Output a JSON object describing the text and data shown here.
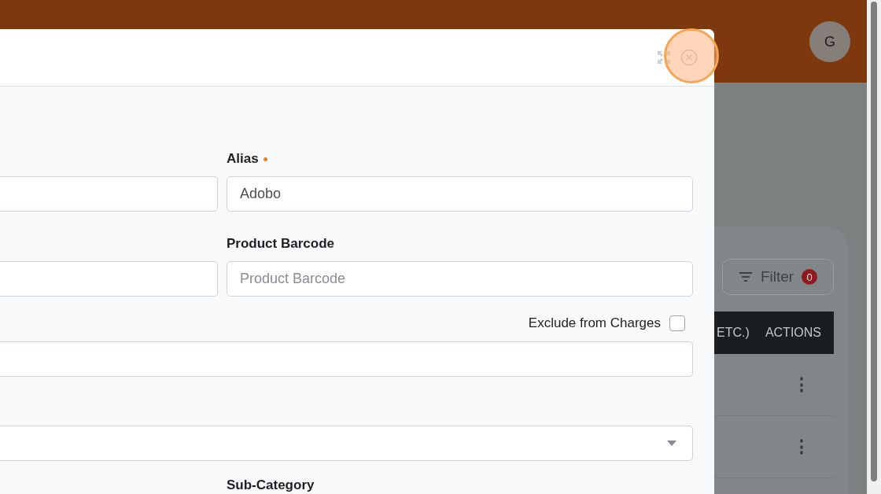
{
  "header": {
    "avatar": "G"
  },
  "list_card": {
    "filter": {
      "label": "Filter",
      "badge": "0"
    },
    "table": {
      "columns": [
        "ETC.)",
        "ACTIONS"
      ],
      "rows": [
        {
          "actions": "⋮"
        },
        {
          "actions": "⋮"
        }
      ]
    }
  },
  "modal": {
    "fields": [
      {
        "kind": "input"
      },
      {
        "kind": "input",
        "label": "Alias",
        "required": true,
        "value": "Adobo"
      },
      {
        "kind": "input"
      },
      {
        "kind": "input",
        "label": "Product Barcode",
        "required": false,
        "placeholder": "Product Barcode"
      }
    ],
    "exclude_from_charges": {
      "label": "Exclude from Charges",
      "checked": false
    },
    "wide_fields": [
      {
        "kind": "input"
      },
      {
        "kind": "select"
      }
    ],
    "next_row_label": "Sub-Category"
  }
}
